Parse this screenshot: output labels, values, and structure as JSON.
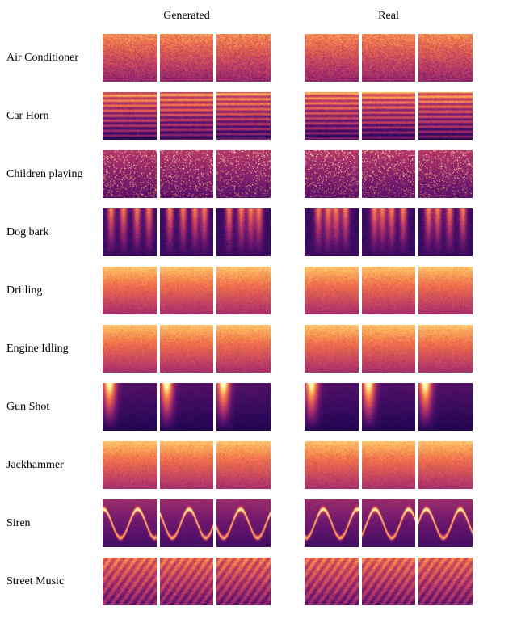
{
  "headers": {
    "generated": "Generated",
    "real": "Real"
  },
  "categories": [
    {
      "label": "Air Conditioner",
      "pattern": "dense"
    },
    {
      "label": "Car Horn",
      "pattern": "banded"
    },
    {
      "label": "Children playing",
      "pattern": "speckle"
    },
    {
      "label": "Dog bark",
      "pattern": "bursty"
    },
    {
      "label": "Drilling",
      "pattern": "solid-warm"
    },
    {
      "label": "Engine Idling",
      "pattern": "solid-warm"
    },
    {
      "label": "Gun Shot",
      "pattern": "impulse"
    },
    {
      "label": "Jackhammer",
      "pattern": "solid-warm"
    },
    {
      "label": "Siren",
      "pattern": "chirp"
    },
    {
      "label": "Street Music",
      "pattern": "texture"
    }
  ],
  "columns": [
    {
      "key": "generated",
      "panels": 3
    },
    {
      "key": "real",
      "panels": 3
    }
  ]
}
